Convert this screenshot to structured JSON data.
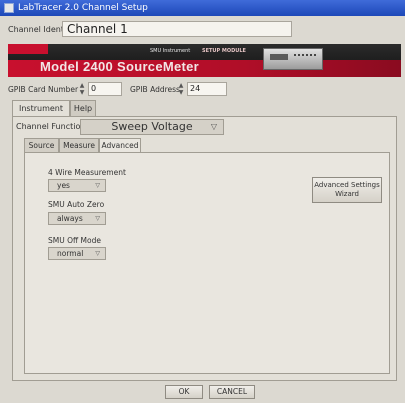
{
  "window": {
    "title": "LabTracer 2.0 Channel Setup",
    "icon": "app-icon"
  },
  "channel": {
    "label": "Channel Identifier",
    "value": "Channel 1"
  },
  "banner": {
    "model": "Model 2400 SourceMeter",
    "tag": "SMU Instrument",
    "setup_tag": "SETUP MODULE",
    "brand_color": "#c8102e"
  },
  "gpib": {
    "card_label": "GPIB Card Number",
    "card_value": "0",
    "address_label": "GPIB Address",
    "address_value": "24"
  },
  "main_tabs": [
    {
      "label": "Instrument Setup"
    },
    {
      "label": "Help"
    }
  ],
  "channel_function": {
    "label": "Channel Function",
    "value": "Sweep Voltage"
  },
  "sub_tabs": [
    {
      "label": "Source"
    },
    {
      "label": "Measure"
    },
    {
      "label": "Advanced"
    }
  ],
  "advanced": {
    "four_wire": {
      "label": "4 Wire Measurement",
      "value": "yes"
    },
    "auto_zero": {
      "label": "SMU Auto Zero",
      "value": "always"
    },
    "off_mode": {
      "label": "SMU Off Mode",
      "value": "normal"
    },
    "settings_button": {
      "line1": "Advanced Settings",
      "line2": "Wizard"
    }
  },
  "footer": {
    "ok": "OK",
    "cancel": "CANCEL"
  }
}
